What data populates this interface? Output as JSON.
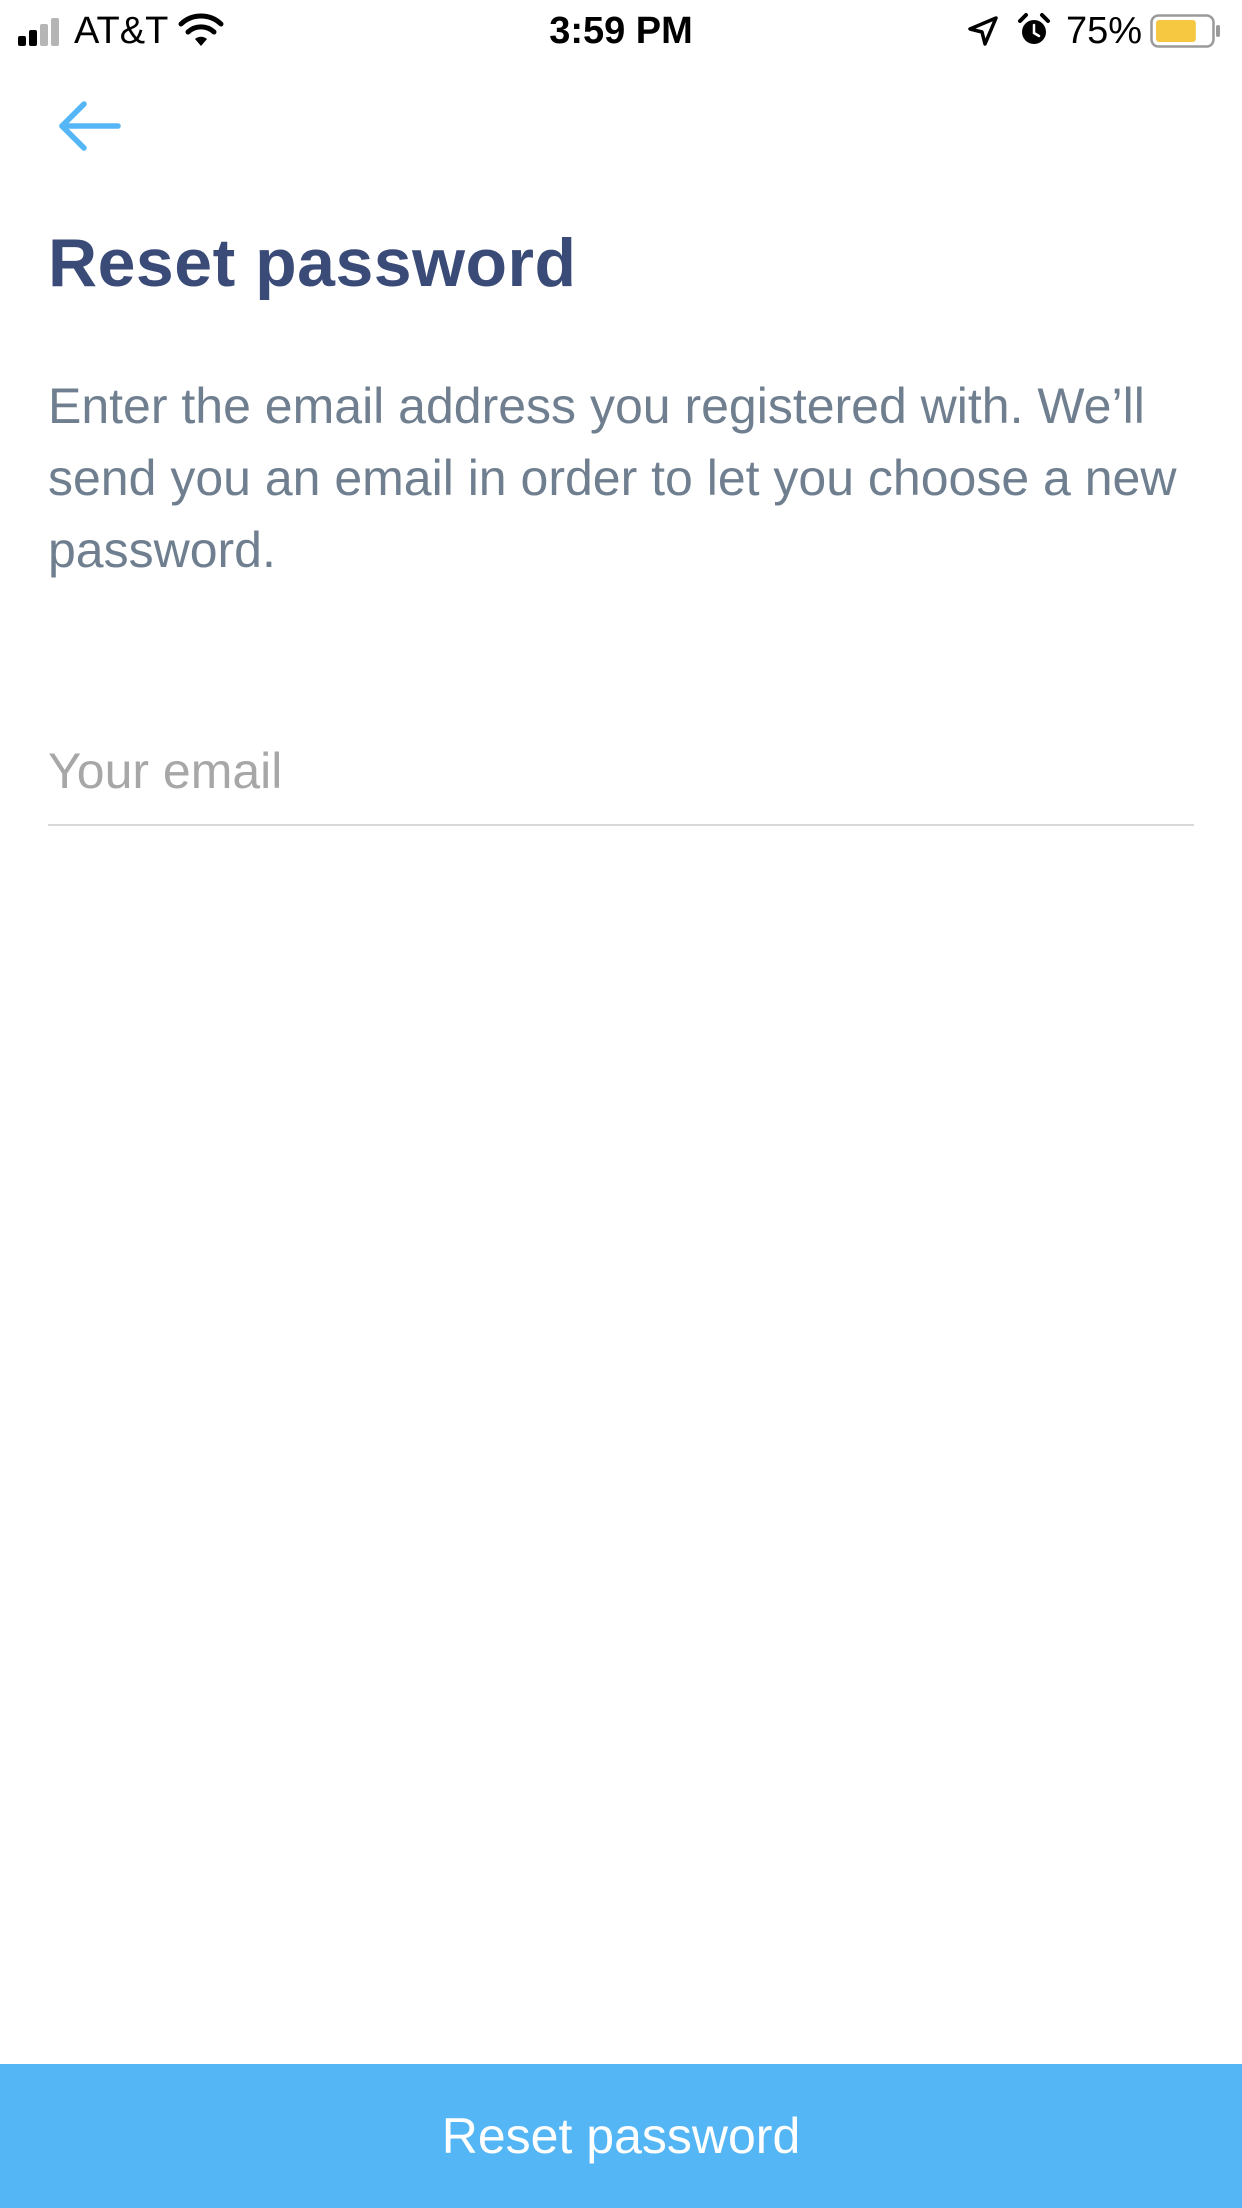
{
  "status_bar": {
    "carrier": "AT&T",
    "time": "3:59 PM",
    "battery_percent": "75%",
    "battery_level": 0.75,
    "battery_color": "#f6c842",
    "icons": [
      "cellular-signal-icon",
      "wifi-icon",
      "location-arrow-icon",
      "alarm-clock-icon",
      "battery-icon"
    ]
  },
  "nav": {
    "back_icon": "arrow-left-icon",
    "accent_color": "#55b6f6"
  },
  "page": {
    "title": "Reset password",
    "description": "Enter the email address you registered with. We’ll send you an email in order to let you choose a new password."
  },
  "form": {
    "email": {
      "value": "",
      "placeholder": "Your email"
    },
    "submit_label": "Reset password"
  },
  "colors": {
    "title": "#3b4b78",
    "body_text": "#6f7f8f",
    "placeholder": "#a7a7a7",
    "button_bg": "#55b6f6",
    "button_text": "#ffffff"
  }
}
